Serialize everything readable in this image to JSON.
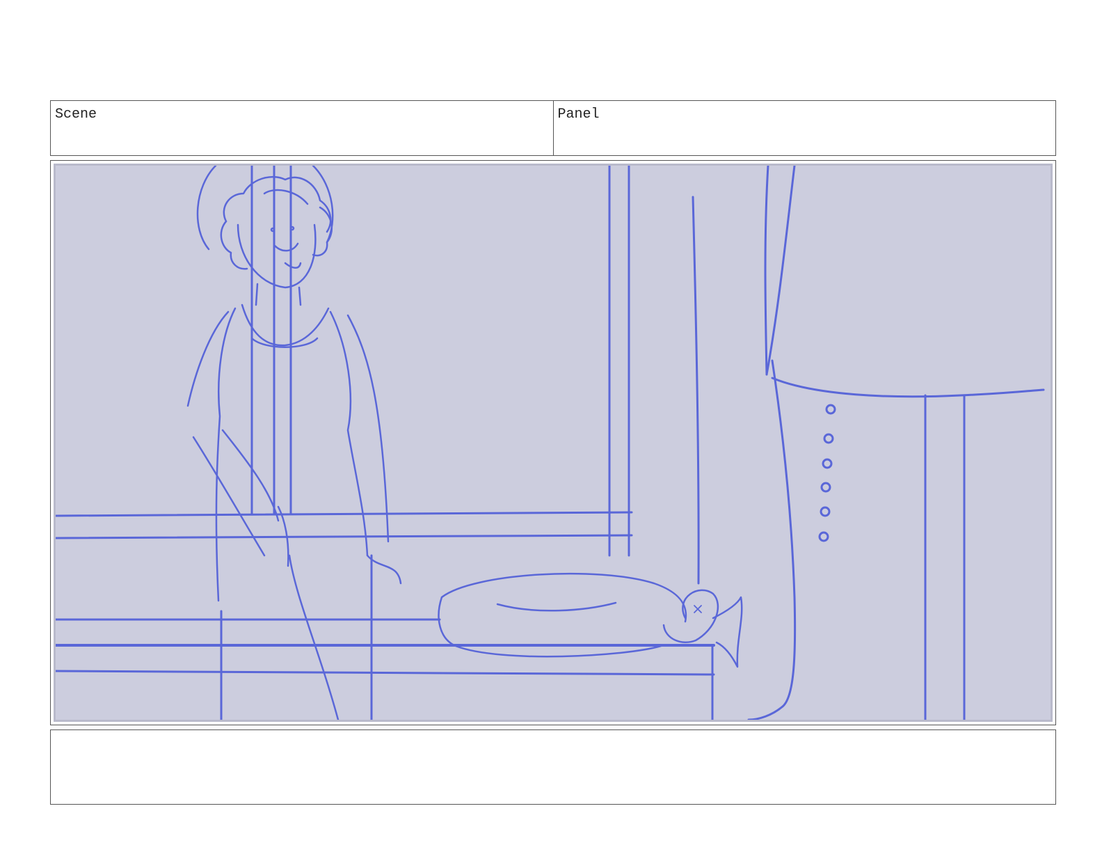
{
  "header": {
    "scene_label": "Scene",
    "panel_label": "Panel"
  },
  "frame": {
    "background_color": "#cccdde",
    "line_color": "#5a67d8"
  },
  "notes": {
    "text": ""
  }
}
